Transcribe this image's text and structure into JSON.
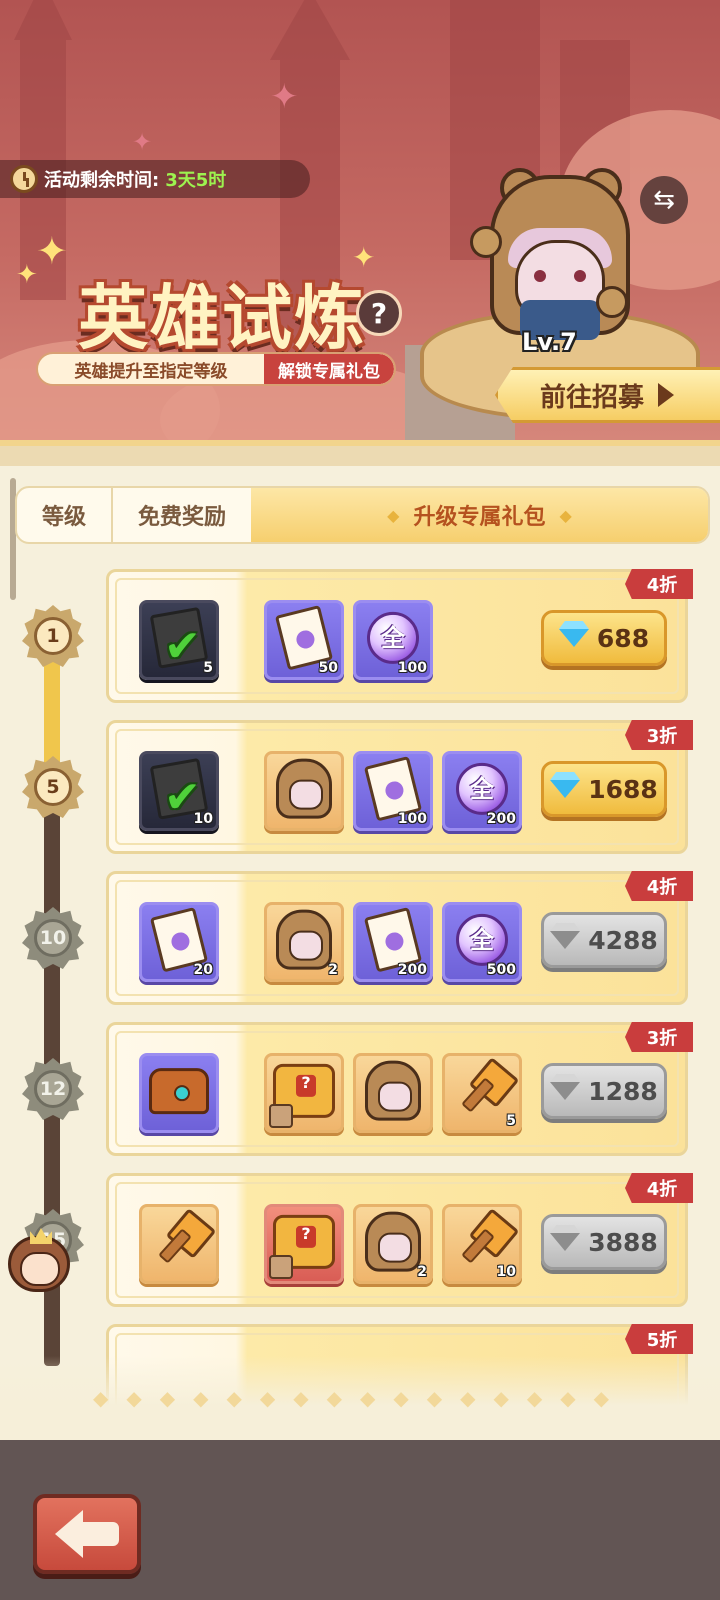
{
  "event": {
    "timer_label": "活动剩余时间:",
    "timer_value": "3天5时",
    "title": "英雄试炼",
    "help_symbol": "?",
    "subtitle_left": "英雄提升至指定等级",
    "subtitle_right": "解锁专属礼包"
  },
  "hero": {
    "level_text": "Lv.7",
    "recruit_label": "前往招募",
    "swap_icon": "swap-icon"
  },
  "tabs": [
    {
      "label": "等级"
    },
    {
      "label": "免费奖励"
    },
    {
      "label": "升级专属礼包",
      "selected": true
    }
  ],
  "rows": [
    {
      "level": "1",
      "reached": true,
      "discount": "4折",
      "free_item": {
        "icon": "integral-book-claimed-icon",
        "qty": "5",
        "claimed": true
      },
      "gift_items": [
        {
          "icon": "integral-scroll-icon",
          "qty": "50"
        },
        {
          "icon": "universal-orb-icon",
          "qty": "100",
          "glyph": "全"
        }
      ],
      "price": "688",
      "price_style": "gold"
    },
    {
      "level": "5",
      "reached": true,
      "discount": "3折",
      "free_item": {
        "icon": "integral-book-claimed-icon",
        "qty": "10",
        "claimed": true
      },
      "gift_items": [
        {
          "icon": "bear-hero-icon",
          "qty": ""
        },
        {
          "icon": "integral-scroll-icon",
          "qty": "100"
        },
        {
          "icon": "universal-orb-icon",
          "qty": "200",
          "glyph": "全"
        }
      ],
      "price": "1688",
      "price_style": "gold"
    },
    {
      "level": "10",
      "reached": false,
      "discount": "4折",
      "free_item": {
        "icon": "integral-scroll-icon",
        "qty": "20"
      },
      "gift_items": [
        {
          "icon": "bear-hero-icon",
          "qty": "2"
        },
        {
          "icon": "integral-scroll-icon",
          "qty": "200"
        },
        {
          "icon": "universal-orb-icon",
          "qty": "500",
          "glyph": "全"
        }
      ],
      "price": "4288",
      "price_style": "gray"
    },
    {
      "level": "12",
      "reached": false,
      "discount": "3折",
      "free_item": {
        "icon": "treasure-chest-icon",
        "qty": ""
      },
      "gift_items": [
        {
          "icon": "golden-hero-chest-icon",
          "qty": ""
        },
        {
          "icon": "bear-hero-icon",
          "qty": ""
        },
        {
          "icon": "hammer-icon",
          "qty": "5"
        }
      ],
      "price": "1288",
      "price_style": "gray"
    },
    {
      "level": "15",
      "reached": false,
      "discount": "4折",
      "free_item": {
        "icon": "hammer-icon",
        "qty": ""
      },
      "gift_items": [
        {
          "icon": "red-hero-chest-icon",
          "qty": ""
        },
        {
          "icon": "bear-hero-icon",
          "qty": "2"
        },
        {
          "icon": "hammer-icon",
          "qty": "10"
        }
      ],
      "price": "3888",
      "price_style": "gray"
    },
    {
      "level": "",
      "reached": false,
      "discount": "5折",
      "partial": true
    }
  ],
  "footer": {
    "back_icon": "back-arrow-icon"
  },
  "colors": {
    "accent_gold": "#f0bb3d",
    "discount_red": "#c93d3d",
    "timer_green": "#9df24f"
  }
}
